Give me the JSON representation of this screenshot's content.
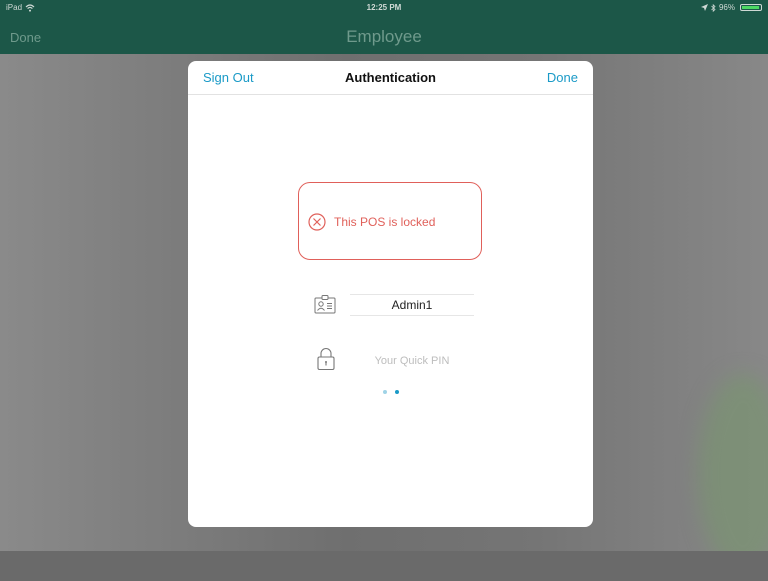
{
  "status_bar": {
    "carrier": "iPad",
    "time": "12:25 PM",
    "battery_percent": "96%",
    "battery_level": 0.96,
    "icons": [
      "wifi-icon",
      "location-arrow-icon",
      "bluetooth-icon",
      "battery-icon"
    ]
  },
  "nav": {
    "done_label": "Done",
    "title": "Employee"
  },
  "modal": {
    "sign_out_label": "Sign Out",
    "title": "Authentication",
    "done_label": "Done",
    "alert_text": "This POS is locked",
    "username_value": "Admin1",
    "pin_placeholder": "Your Quick PIN",
    "page_count": 2,
    "active_page": 2
  },
  "colors": {
    "nav_bg": "#1c5748",
    "accent": "#1a9ac7",
    "error": "#e0605a"
  }
}
